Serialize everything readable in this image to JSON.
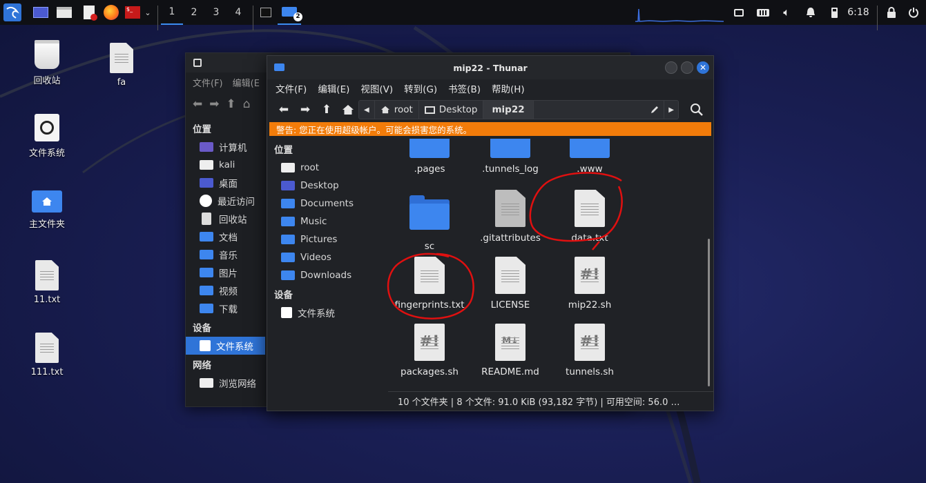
{
  "panel": {
    "workspaces": [
      "1",
      "2",
      "3",
      "4"
    ],
    "active_workspace": "1",
    "window_badge": "2",
    "clock": "6:18",
    "tray_icons": [
      "network-icon",
      "keyboard-icon",
      "volume-icon",
      "bell-icon",
      "battery-icon",
      "lock-icon",
      "power-icon"
    ]
  },
  "desktop": {
    "icons": [
      {
        "label": "回收站",
        "icon": "trash-icon"
      },
      {
        "label": "fa",
        "icon": "text-file-icon"
      },
      {
        "label": "文件系统",
        "icon": "drive-icon"
      },
      {
        "label": "主文件夹",
        "icon": "home-folder-icon"
      },
      {
        "label": "11.txt",
        "icon": "text-file-icon"
      },
      {
        "label": "111.txt",
        "icon": "text-file-icon"
      }
    ]
  },
  "back_window": {
    "menu": [
      "文件(F)",
      "编辑(E"
    ],
    "places_heading": "位置",
    "places": [
      "计算机",
      "kali",
      "桌面",
      "最近访问",
      "回收站",
      "文档",
      "音乐",
      "图片",
      "视频",
      "下载"
    ],
    "devices_heading": "设备",
    "devices": [
      "文件系统"
    ],
    "network_heading": "网络",
    "network": [
      "浏览网络"
    ]
  },
  "window": {
    "title": "mip22 - Thunar",
    "menu": [
      "文件(F)",
      "编辑(E)",
      "视图(V)",
      "转到(G)",
      "书签(B)",
      "帮助(H)"
    ],
    "breadcrumbs": [
      "root",
      "Desktop",
      "mip22"
    ],
    "warning": "警告: 您正在使用超级帐户。可能会损害您的系统。",
    "places_heading": "位置",
    "places": [
      "root",
      "Desktop",
      "Documents",
      "Music",
      "Pictures",
      "Videos",
      "Downloads"
    ],
    "devices_heading": "设备",
    "devices": [
      "文件系统"
    ],
    "files": [
      {
        "name": ".pages",
        "type": "folder"
      },
      {
        "name": ".tunnels_log",
        "type": "folder"
      },
      {
        "name": ".www",
        "type": "folder"
      },
      {
        "name": "sc",
        "type": "folder"
      },
      {
        "name": ".gitattributes",
        "type": "text"
      },
      {
        "name": "data.txt",
        "type": "text"
      },
      {
        "name": "fingerprints.txt",
        "type": "text"
      },
      {
        "name": "LICENSE",
        "type": "text"
      },
      {
        "name": "mip22.sh",
        "type": "script"
      },
      {
        "name": "packages.sh",
        "type": "script"
      },
      {
        "name": "README.md",
        "type": "markdown"
      },
      {
        "name": "tunnels.sh",
        "type": "script"
      }
    ],
    "status": "10 个文件夹 | 8 个文件: 91.0 KiB (93,182 字节) | 可用空间: 56.0 …"
  },
  "colors": {
    "accent": "#2f74d8",
    "warning": "#f27c0a",
    "annotation": "#e01010"
  }
}
